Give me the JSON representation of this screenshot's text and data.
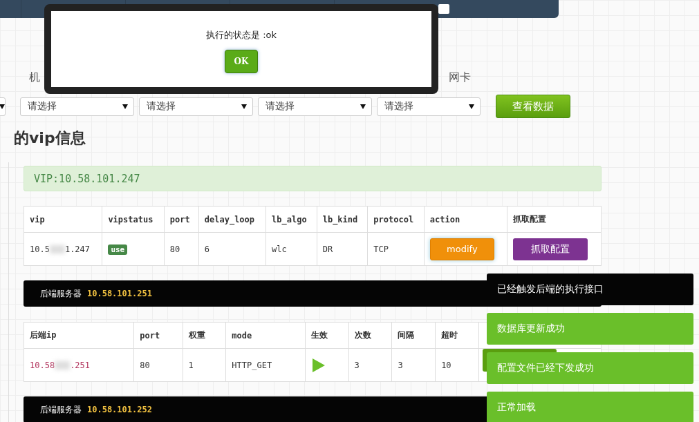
{
  "filters": {
    "labels": [
      {
        "text": "机"
      },
      {
        "text": "网卡"
      }
    ],
    "selects": [
      {
        "kind": "cut"
      },
      {
        "value": "请选择"
      },
      {
        "value": "请选择"
      },
      {
        "value": "请选择"
      },
      {
        "value": "请选择"
      }
    ],
    "button": "查看数据"
  },
  "vip_title": "的vip信息",
  "vip_alert": "VIP:10.58.101.247",
  "vip_table": {
    "columns": [
      "vip",
      "vipstatus",
      "port",
      "delay_loop",
      "lb_algo",
      "lb_kind",
      "protocol",
      "action",
      "抓取配置"
    ],
    "rows": [
      {
        "vip_prefix": "10.5",
        "vip_suffix": "1.247",
        "status": "use",
        "port": "80",
        "delay_loop": "6",
        "lb_algo": "wlc",
        "lb_kind": "DR",
        "protocol": "TCP",
        "modify": "modify",
        "fetch": "抓取配置"
      }
    ]
  },
  "backends": [
    {
      "label": "后端服务器",
      "ip": "10.58.101.251",
      "columns": [
        "后端ip",
        "port",
        "权重",
        "mode",
        "生效",
        "次数",
        "间隔",
        "超时"
      ],
      "rows": [
        {
          "ip_prefix": "10.58",
          "ip_suffix": ".251",
          "port": "80",
          "weight": "1",
          "mode": "HTTP_GET",
          "active": true,
          "tries": "3",
          "interval": "3",
          "timeout": "10"
        }
      ]
    },
    {
      "label": "后端服务器",
      "ip": "10.58.101.252"
    }
  ],
  "dialog": {
    "message": "执行的状态是 :ok",
    "button": "OK"
  },
  "toasts": [
    {
      "text": "已经触发后端的执行接口",
      "color": "#050505"
    },
    {
      "text": "数据库更新成功",
      "color": "#6abf2a"
    },
    {
      "text": "配置文件已经下发成功",
      "color": "#6abf2a"
    },
    {
      "text": "正常加载",
      "color": "#6abf2a"
    }
  ]
}
